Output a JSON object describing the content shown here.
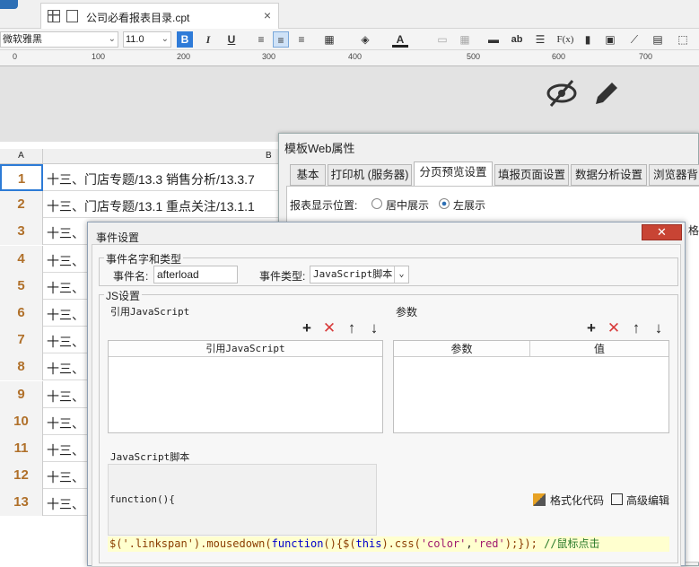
{
  "tab": {
    "title": "公司必看报表目录.cpt",
    "close": "×"
  },
  "toolbar": {
    "font": "微软雅黑",
    "size": "11.0",
    "bold": "B",
    "italic": "I",
    "underline": "U",
    "ab": "ab",
    "fx": "F(x)"
  },
  "ruler": {
    "marks": [
      "0",
      "100",
      "200",
      "300",
      "400",
      "500",
      "600",
      "700"
    ]
  },
  "sheet": {
    "col_a": "A",
    "col_b": "B",
    "rows": [
      {
        "n": "1",
        "text": "十三、门店专题/13.3 销售分析/13.3.7"
      },
      {
        "n": "2",
        "text": "十三、门店专题/13.1 重点关注/13.1.1"
      },
      {
        "n": "3",
        "text": "十三、"
      },
      {
        "n": "4",
        "text": "十三、"
      },
      {
        "n": "5",
        "text": "十三、"
      },
      {
        "n": "6",
        "text": "十三、"
      },
      {
        "n": "7",
        "text": "十三、"
      },
      {
        "n": "8",
        "text": "十三、"
      },
      {
        "n": "9",
        "text": "十三、"
      },
      {
        "n": "10",
        "text": "十三、"
      },
      {
        "n": "11",
        "text": "十三、"
      },
      {
        "n": "12",
        "text": "十三、"
      },
      {
        "n": "13",
        "text": "十三、"
      }
    ]
  },
  "webdlg": {
    "title": "模板Web属性",
    "tabs": [
      "基本",
      "打印机 (服务器)",
      "分页预览设置",
      "填报页面设置",
      "数据分析设置",
      "浏览器背"
    ],
    "position_label": "报表显示位置:",
    "opt_center": "居中展示",
    "opt_left": "左展示",
    "cut_right": "格"
  },
  "evdlg": {
    "title": "事件设置",
    "close": "✕",
    "group_name": "事件名字和类型",
    "event_name_label": "事件名:",
    "event_name_value": "afterload",
    "event_type_label": "事件类型:",
    "event_type_value": "JavaScript脚本",
    "js_group": "JS设置",
    "ref_js_label": "引用JavaScript",
    "params_label": "参数",
    "ref_js_col": "引用JavaScript",
    "param_col": "参数",
    "value_col": "值",
    "script_label": "JavaScript脚本",
    "function_text": "function(){",
    "format_code": "格式化代码",
    "advanced_edit": "高级编辑",
    "code_prefix": "$('.linkspan').mousedown(",
    "code_kw1": "function",
    "code_mid": "(){$(",
    "code_kw2": "this",
    "code_mid2": ").css(",
    "code_str1": "'color'",
    "code_comma": ",",
    "code_str2": "'red'",
    "code_end": ");});",
    "code_comment": "//鼠标点击"
  }
}
